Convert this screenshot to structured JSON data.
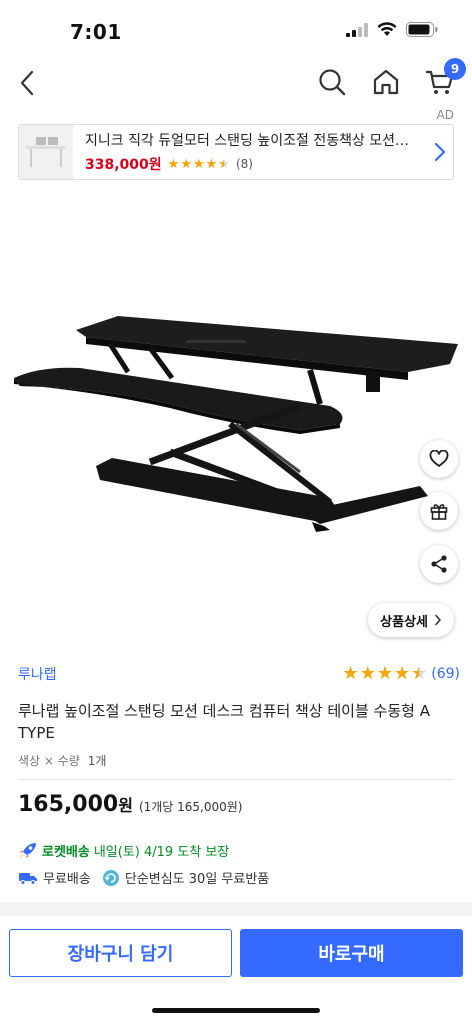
{
  "status_bar": {
    "time": "7:01"
  },
  "nav": {
    "cart_count": "9"
  },
  "ad": {
    "label": "AD",
    "title": "지니크 직각 듀얼모터 스탠딩 높이조절 전동책상 모션…",
    "price": "338,000원",
    "rating": 4.5,
    "review_count": "(8)"
  },
  "product": {
    "detail_button_label": "상품상세",
    "brand": "루나랩",
    "rating": 4.5,
    "review_count": "(69)",
    "title": "루나랩 높이조절 스탠딩 모션 데스크 컴퓨터 책상 테이블 수동형 A TYPE",
    "option_label": "색상 × 수량",
    "option_qty": "1개",
    "price": "165,000",
    "price_unit": "원",
    "unit_price": "(1개당 165,000원)"
  },
  "delivery": {
    "rocket_label": "로켓배송",
    "arrive_text": "내일(토) 4/19 도착 보장",
    "free_shipping": "무료배송",
    "free_return": "단순변심도 30일 무료반품"
  },
  "actions": {
    "cart_button": "장바구니 담기",
    "buy_button": "바로구매"
  },
  "colors": {
    "accent": "#346aff",
    "price_red": "#d6001c",
    "rocket_green": "#008c25",
    "star": "#f5a700"
  }
}
